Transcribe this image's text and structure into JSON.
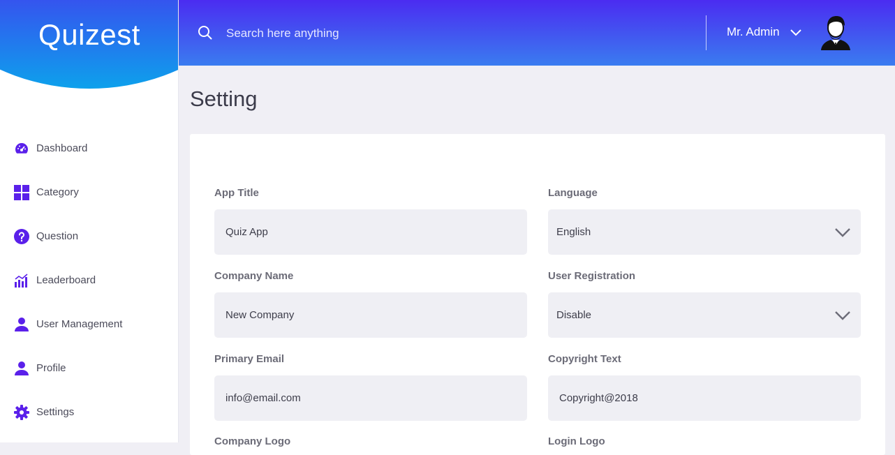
{
  "app": {
    "logo": "Quizest"
  },
  "sidebar": {
    "items": [
      {
        "label": "Dashboard",
        "icon": "dashboard-gauge-icon"
      },
      {
        "label": "Category",
        "icon": "category-grid-icon"
      },
      {
        "label": "Question",
        "icon": "question-circle-icon"
      },
      {
        "label": "Leaderboard",
        "icon": "leaderboard-chart-icon"
      },
      {
        "label": "User Management",
        "icon": "user-icon"
      },
      {
        "label": "Profile",
        "icon": "profile-user-icon"
      },
      {
        "label": "Settings",
        "icon": "gear-icon"
      }
    ],
    "icon_color": "#5a20ea"
  },
  "header": {
    "search_placeholder": "Search here anything",
    "user_name": "Mr. Admin"
  },
  "page": {
    "title": "Setting"
  },
  "form": {
    "app_title": {
      "label": "App Title",
      "value": "Quiz App"
    },
    "language": {
      "label": "Language",
      "value": "English"
    },
    "company_name": {
      "label": "Company Name",
      "value": "New Company"
    },
    "user_registration": {
      "label": "User Registration",
      "value": "Disable"
    },
    "primary_email": {
      "label": "Primary Email",
      "value": "info@email.com"
    },
    "copyright_text": {
      "label": "Copyright Text",
      "value": "Copyright@2018"
    },
    "company_logo": {
      "label": "Company Logo"
    },
    "login_logo": {
      "label": "Login Logo"
    }
  },
  "colors": {
    "header_gradient_top": "#4b2cf1",
    "header_gradient_bottom": "#3a7cf0",
    "page_background": "#f0eff5",
    "field_background": "#efeff4"
  }
}
